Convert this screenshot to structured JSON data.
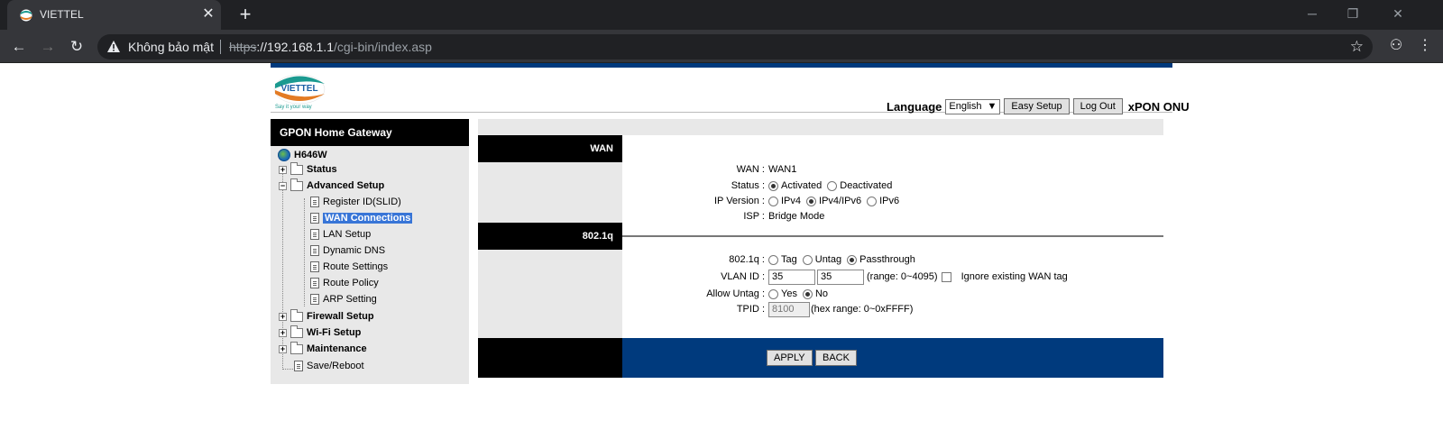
{
  "browser": {
    "tab_title": "VIETTEL",
    "security_warning": "Không bảo mật",
    "url_scheme": "https",
    "url_host": "://192.168.1.1",
    "url_path": "/cgi-bin/index.asp"
  },
  "header": {
    "logo_text": "VIETTEL",
    "logo_slogan": "Say it your way",
    "language_label": "Language",
    "language_value": "English",
    "easy_setup": "Easy Setup",
    "log_out": "Log Out",
    "product": "xPON ONU"
  },
  "nav": {
    "title": "GPON Home Gateway",
    "root": "H646W",
    "items": [
      {
        "label": "Status"
      },
      {
        "label": "Advanced Setup"
      },
      {
        "label": "Register ID(SLID)"
      },
      {
        "label": "WAN Connections"
      },
      {
        "label": "LAN Setup"
      },
      {
        "label": "Dynamic DNS"
      },
      {
        "label": "Route Settings"
      },
      {
        "label": "Route Policy"
      },
      {
        "label": "ARP Setting"
      },
      {
        "label": "Firewall Setup"
      },
      {
        "label": "Wi-Fi Setup"
      },
      {
        "label": "Maintenance"
      },
      {
        "label": "Save/Reboot"
      }
    ]
  },
  "wan": {
    "section_title": "WAN",
    "wan_label": "WAN :",
    "wan_value": "WAN1",
    "status_label": "Status :",
    "status_activated": "Activated",
    "status_deactivated": "Deactivated",
    "ipversion_label": "IP Version :",
    "ipv4": "IPv4",
    "ipv4ipv6": "IPv4/IPv6",
    "ipv6": "IPv6",
    "isp_label": "ISP :",
    "isp_value": "Bridge Mode"
  },
  "vlan": {
    "section_title": "802.1q",
    "mode_label": "802.1q :",
    "tag": "Tag",
    "untag": "Untag",
    "passthrough": "Passthrough",
    "vlanid_label": "VLAN ID :",
    "vlanid_value1": "35",
    "vlanid_value2": "35",
    "range_text": "(range: 0~4095)",
    "ignore_text": "Ignore existing WAN tag",
    "allow_untag_label": "Allow Untag :",
    "yes": "Yes",
    "no": "No",
    "tpid_label": "TPID :",
    "tpid_value": "8100",
    "tpid_range": "(hex range: 0~0xFFFF)"
  },
  "actions": {
    "apply": "APPLY",
    "back": "BACK"
  }
}
